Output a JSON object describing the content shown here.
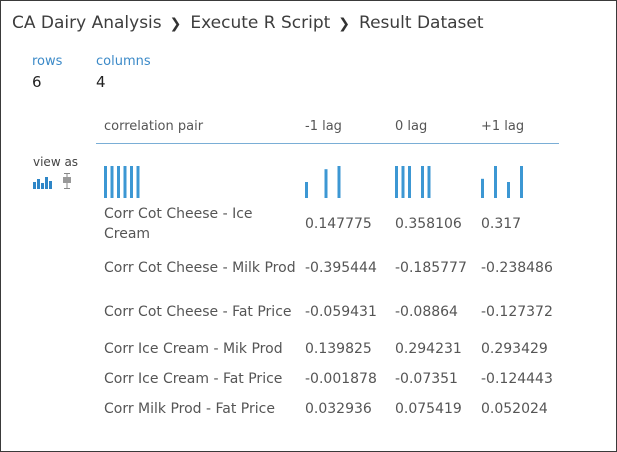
{
  "breadcrumb": [
    "CA Dairy Analysis",
    "Execute R Script",
    "Result Dataset"
  ],
  "stats": {
    "rows_label": "rows",
    "rows_value": "6",
    "columns_label": "columns",
    "columns_value": "4"
  },
  "view_as": {
    "label": "view as",
    "icons": [
      "histogram-icon",
      "boxplot-icon"
    ]
  },
  "table": {
    "headers": [
      "correlation pair",
      "-1 lag",
      "0 lag",
      "+1 lag"
    ],
    "rows": [
      [
        "Corr Cot Cheese - Ice Cream",
        "0.147775",
        "0.358106",
        "0.317"
      ],
      [
        "Corr Cot Cheese - Milk Prod",
        "-0.395444",
        "-0.185777",
        "-0.238486"
      ],
      [
        "Corr Cot Cheese - Fat Price",
        "-0.059431",
        "-0.08864",
        "-0.127372"
      ],
      [
        "Corr Ice Cream - Mik Prod",
        "0.139825",
        "0.294231",
        "0.293429"
      ],
      [
        "Corr Ice Cream - Fat Price",
        "-0.001878",
        "-0.07351",
        "-0.124443"
      ],
      [
        "Corr Milk Prod - Fat Price",
        "0.032936",
        "0.075419",
        "0.052024"
      ]
    ]
  },
  "histograms": {
    "color": "#3c97d3",
    "columns": [
      [
        1,
        1,
        1,
        1,
        1,
        1
      ],
      [
        0.5,
        0,
        0,
        0.9,
        0,
        1
      ],
      [
        1,
        1,
        1,
        0,
        1,
        1
      ],
      [
        0.6,
        0,
        1,
        0,
        0.5,
        0,
        1
      ]
    ]
  }
}
